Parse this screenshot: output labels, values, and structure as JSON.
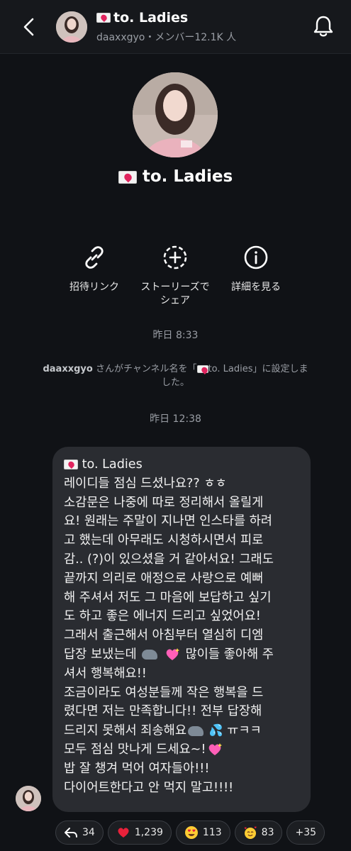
{
  "header": {
    "title": "to. Ladies",
    "subtitle": "daaxxgyo・メンバー12.1K 人"
  },
  "profile": {
    "name": "to. Ladies"
  },
  "actions": [
    {
      "label": "招待リンク",
      "icon": "link-icon"
    },
    {
      "label": "ストーリーズで\nシェア",
      "icon": "add-story-icon"
    },
    {
      "label": "詳細を見る",
      "icon": "info-icon"
    }
  ],
  "timeline": {
    "time1": "昨日 8:33",
    "system_user": "daaxxgyo",
    "system_before": " さんがチャンネル名を「",
    "system_name": "to. Ladies",
    "system_after": "」に設定しました。",
    "time2": "昨日 12:38"
  },
  "message": {
    "lines": [
      "to. Ladies",
      "레이디들 점심 드셨나요?? ㅎㅎ",
      "소감문은 나중에 따로 정리해서 올릴게",
      "요! 원래는 주말이 지나면 인스타를 하려",
      "고 했는데 아무래도 시청하시면서 피로",
      "감.. (?)이 있으셨을 거 같아서요! 그래도",
      "끝까지 의리로 애정으로 사랑으로 예뻐",
      "해 주셔서 저도 그 마음에 보답하고 싶기",
      "도 하고 좋은 에너지 드리고 싶었어요!",
      "그래서 출근해서 아침부터 열심히 디엠",
      "답장 보냈는데",
      "많이들 좋아해 주",
      "셔서 행복해요!!",
      "조금이라도 여성분들께 작은 행복을 드",
      "렸다면 저는 만족합니다!! 전부 답장해",
      "드리지 못해서 죄송해요",
      "ㅠㅋㅋ",
      "모두 점심 맛나게 드세요~!",
      "밥 잘 챙겨 먹어 여자들아!!!",
      "다이어트한다고 안 먹지 말고!!!!"
    ]
  },
  "reactions": [
    {
      "icon": "reply-icon",
      "count": "34"
    },
    {
      "icon": "red-heart-emoji",
      "count": "1,239"
    },
    {
      "icon": "heart-eyes-emoji",
      "count": "113"
    },
    {
      "icon": "smiling-hearts-emoji",
      "count": "83"
    },
    {
      "icon": "",
      "count": "+35"
    }
  ],
  "colors": {
    "background": "#101216",
    "header_bg": "#16181c",
    "bubble": "#2a2c31",
    "muted_text": "#9a9ea5",
    "heart_red": "#e0245e"
  }
}
